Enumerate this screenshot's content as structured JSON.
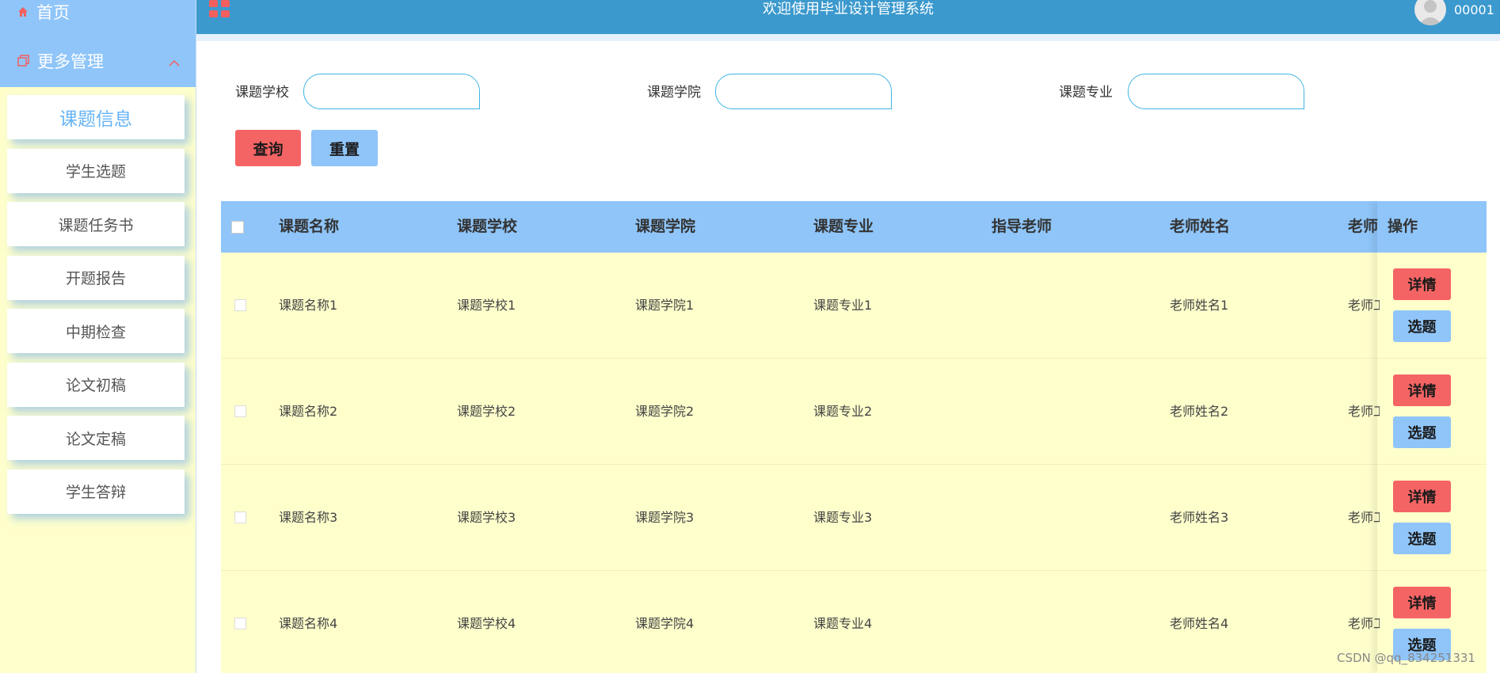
{
  "header": {
    "title": "欢迎使用毕业设计管理系统",
    "user": "00001"
  },
  "sidebar": {
    "home_label": "首页",
    "more_label": "更多管理",
    "items": [
      {
        "label": "课题信息"
      },
      {
        "label": "学生选题"
      },
      {
        "label": "课题任务书"
      },
      {
        "label": "开题报告"
      },
      {
        "label": "中期检查"
      },
      {
        "label": "论文初稿"
      },
      {
        "label": "论文定稿"
      },
      {
        "label": "学生答辩"
      }
    ]
  },
  "search": {
    "fields": [
      {
        "label": "课题学校",
        "value": ""
      },
      {
        "label": "课题学院",
        "value": ""
      },
      {
        "label": "课题专业",
        "value": ""
      }
    ],
    "query_label": "查询",
    "reset_label": "重置"
  },
  "table": {
    "columns": [
      "课题名称",
      "课题学校",
      "课题学院",
      "课题专业",
      "指导老师",
      "老师姓名",
      "老师",
      "操作"
    ],
    "rows": [
      {
        "name": "课题名称1",
        "school": "课题学校1",
        "college": "课题学院1",
        "major": "课题专业1",
        "advisor": "",
        "teacher": "老师姓名1",
        "teacher_extra": "老师工"
      },
      {
        "name": "课题名称2",
        "school": "课题学校2",
        "college": "课题学院2",
        "major": "课题专业2",
        "advisor": "",
        "teacher": "老师姓名2",
        "teacher_extra": "老师工"
      },
      {
        "name": "课题名称3",
        "school": "课题学校3",
        "college": "课题学院3",
        "major": "课题专业3",
        "advisor": "",
        "teacher": "老师姓名3",
        "teacher_extra": "老师工"
      },
      {
        "name": "课题名称4",
        "school": "课题学校4",
        "college": "课题学院4",
        "major": "课题专业4",
        "advisor": "",
        "teacher": "老师姓名4",
        "teacher_extra": "老师工"
      }
    ],
    "detail_label": "详情",
    "select_label": "选题"
  },
  "watermark": "CSDN @qq_834251331",
  "colors": {
    "brand_blue": "#3b99cd",
    "light_blue": "#8fc5f9",
    "red": "#f56464",
    "row_bg": "#ffffcc"
  }
}
